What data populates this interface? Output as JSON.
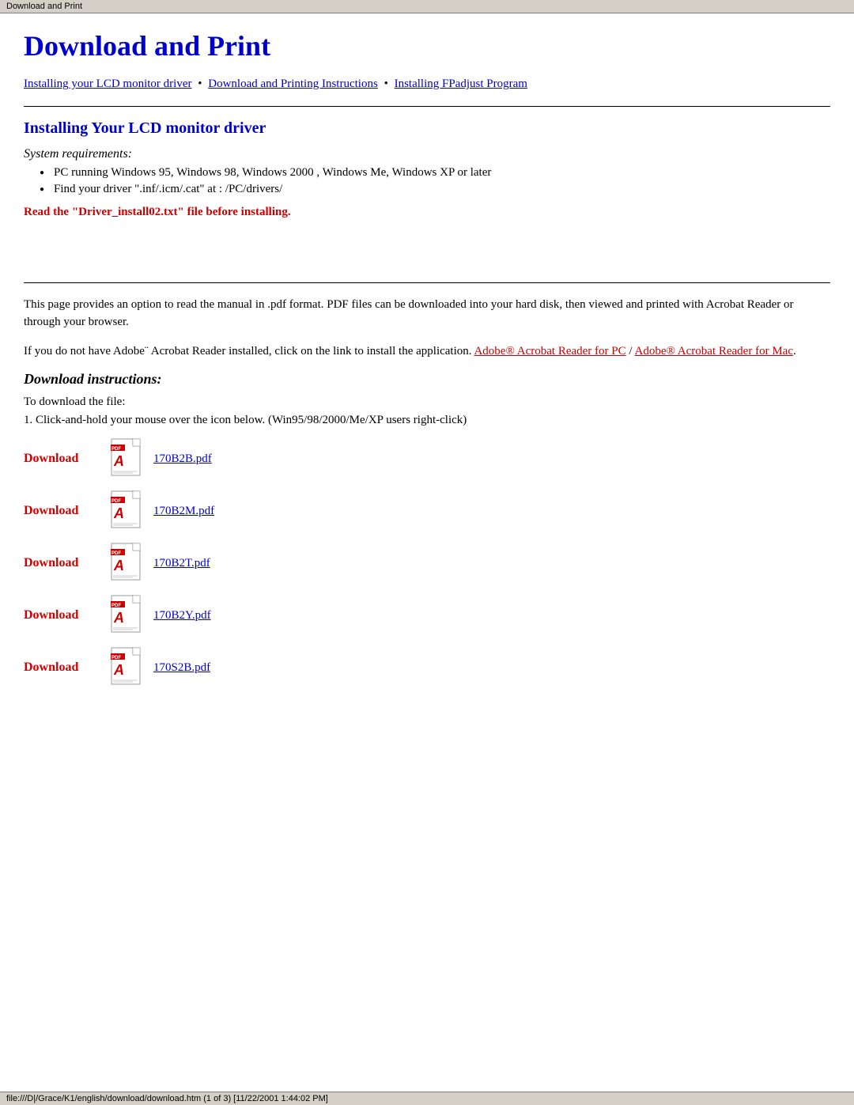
{
  "browser_bar": {
    "title": "Download and Print"
  },
  "page": {
    "title": "Download and Print",
    "breadcrumbs": [
      {
        "label": "Installing your LCD monitor driver",
        "href": "#install-lcd"
      },
      {
        "label": "Download and Printing Instructions",
        "href": "#download-instructions"
      },
      {
        "label": "Installing FPadjust Program",
        "href": "#fpadjust"
      }
    ],
    "section1": {
      "heading": "Installing Your LCD monitor driver",
      "system_requirements_label": "System requirements:",
      "bullet_items": [
        "PC running Windows 95, Windows 98, Windows 2000 , Windows Me, Windows XP or later",
        "Find your driver \".inf/.icm/.cat\" at : /PC/drivers/"
      ],
      "warning": "Read the \"Driver_install02.txt\" file before installing."
    },
    "section2": {
      "intro1": "This page provides an option to read the manual in .pdf format. PDF files can be downloaded into your hard disk, then viewed and printed with Acrobat Reader or through your browser.",
      "intro2_prefix": "If you do not have Adobe¨ Acrobat Reader installed, click on the link to install the application. ",
      "acrobat_pc_label": "Adobe® Acrobat Reader for PC",
      "acrobat_pc_href": "#acrobat-pc",
      "separator": " / ",
      "acrobat_mac_label": "Adobe® Acrobat Reader for Mac",
      "acrobat_mac_href": "#acrobat-mac",
      "intro2_suffix": ".",
      "download_instructions_heading": "Download instructions:",
      "to_download_text": "To download the file:",
      "step1": "1. Click-and-hold your mouse over the icon below. (Win95/98/2000/Me/XP users right-click)",
      "downloads": [
        {
          "label": "Download",
          "filename": "170B2B.pdf",
          "href": "#170B2B"
        },
        {
          "label": "Download",
          "filename": "170B2M.pdf",
          "href": "#170B2M"
        },
        {
          "label": "Download",
          "filename": "170B2T.pdf",
          "href": "#170B2T"
        },
        {
          "label": "Download",
          "filename": "170B2Y.pdf",
          "href": "#170B2Y"
        },
        {
          "label": "Download",
          "filename": "170S2B.pdf",
          "href": "#170S2B"
        }
      ]
    },
    "status_bar": "file:///D|/Grace/K1/english/download/download.htm (1 of 3) [11/22/2001 1:44:02 PM]"
  }
}
